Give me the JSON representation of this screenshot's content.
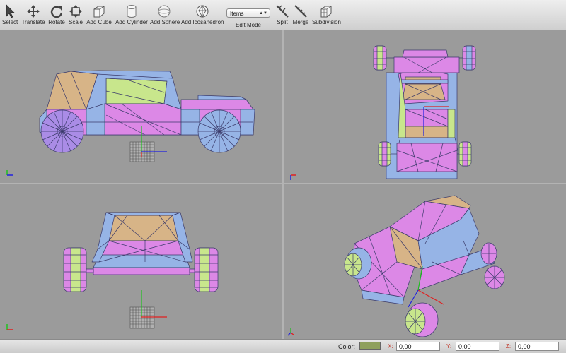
{
  "toolbar": {
    "tools": [
      {
        "label": "Select",
        "icon": "arrow-icon"
      },
      {
        "label": "Translate",
        "icon": "move-icon"
      },
      {
        "label": "Rotate",
        "icon": "rotate-icon"
      },
      {
        "label": "Scale",
        "icon": "scale-icon"
      },
      {
        "label": "Add Cube",
        "icon": "cube-icon"
      },
      {
        "label": "Add Cylinder",
        "icon": "cylinder-icon"
      },
      {
        "label": "Add Sphere",
        "icon": "sphere-icon"
      },
      {
        "label": "Add Icosahedron",
        "icon": "icosahedron-icon"
      },
      {
        "label": "Split",
        "icon": "split-icon"
      },
      {
        "label": "Merge",
        "icon": "merge-icon"
      },
      {
        "label": "Subdivision",
        "icon": "subdivision-icon"
      }
    ],
    "edit_mode": {
      "selected": "Items",
      "label": "Edit Mode"
    }
  },
  "viewports": [
    "side",
    "top",
    "front",
    "perspective"
  ],
  "status": {
    "color_label": "Color:",
    "color_value": "#8ea05c",
    "x_label": "X:",
    "x_value": "0,00",
    "y_label": "Y:",
    "y_value": "0,00",
    "z_label": "Z:",
    "z_value": "0,00"
  },
  "colors": {
    "face_pink": "#dc88e6",
    "face_blue": "#96b4e6",
    "face_tan": "#d7b487",
    "face_green": "#c8e68c",
    "face_lilac": "#aa8ce6",
    "edge": "#3a3a6a",
    "grid": "#4f4f4f",
    "axis_x": "#e02020",
    "axis_y": "#20c020",
    "axis_z": "#2020e0"
  }
}
